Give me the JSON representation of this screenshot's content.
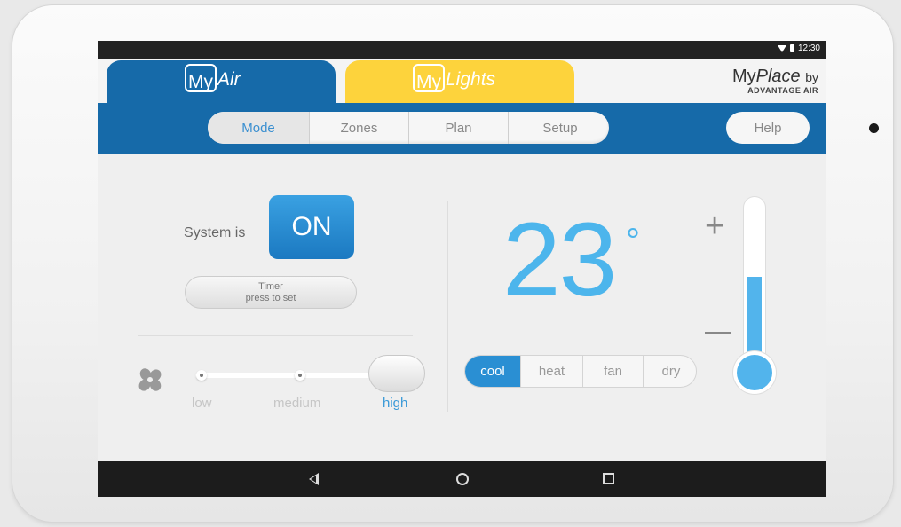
{
  "status_bar": {
    "time": "12:30",
    "wifi_icon": "wifi-icon",
    "battery_icon": "battery-icon"
  },
  "tabs": {
    "myair": {
      "prefix": "My",
      "suffix": "Air",
      "color": "#166aa9"
    },
    "mylights": {
      "prefix": "My",
      "suffix": "Lights",
      "color": "#fdd33c"
    }
  },
  "brand": {
    "line1_a": "My",
    "line1_b": "Place",
    "line1_c": "by",
    "line2": "ADVANTAGE AIR"
  },
  "nav": {
    "items": [
      "Mode",
      "Zones",
      "Plan",
      "Setup"
    ],
    "active": "Mode",
    "help": "Help"
  },
  "system": {
    "label": "System is",
    "state": "ON",
    "timer_title": "Timer",
    "timer_hint": "press to set"
  },
  "fan": {
    "icon": "fan-icon",
    "levels": [
      "low",
      "medium",
      "high"
    ],
    "selected": "high"
  },
  "temperature": {
    "value": "23",
    "unit": "°",
    "plus": "+",
    "setpoint_fill": 0.55
  },
  "modes": {
    "items": [
      "cool",
      "heat",
      "fan",
      "dry"
    ],
    "active": "cool"
  },
  "colors": {
    "accent": "#2a8fd3",
    "temp": "#4cb5ec",
    "nav_blue": "#166aa9",
    "lights_yellow": "#fdd33c"
  }
}
